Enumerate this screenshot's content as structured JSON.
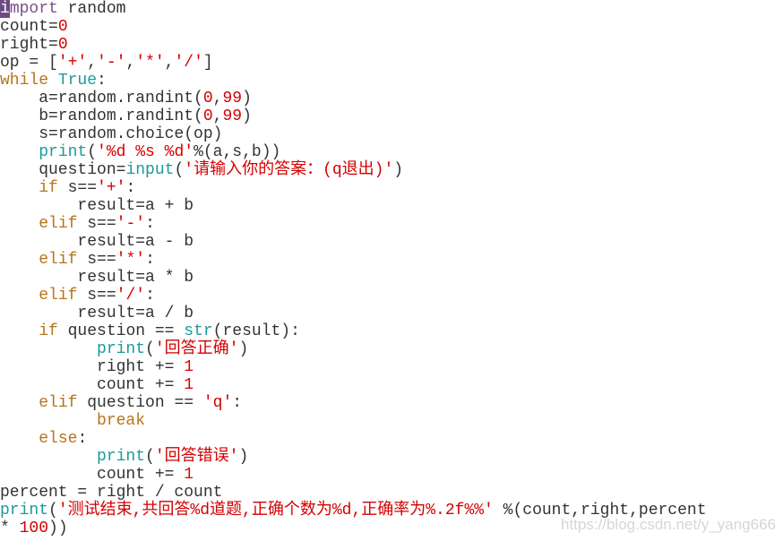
{
  "colors": {
    "keyword": "#b8741a",
    "import": "#7a4f8c",
    "builtin": "#1c9a9a",
    "string": "#d40000",
    "text": "#333333",
    "cursor": "#6b4b80"
  },
  "editor": {
    "lines": [
      [
        {
          "t": "i",
          "c": "cur"
        },
        {
          "t": "mport",
          "c": "imp"
        },
        {
          "t": " random",
          "c": "n"
        }
      ],
      [
        {
          "t": "count=",
          "c": "n"
        },
        {
          "t": "0",
          "c": "str"
        }
      ],
      [
        {
          "t": "right=",
          "c": "n"
        },
        {
          "t": "0",
          "c": "str"
        }
      ],
      [
        {
          "t": "op = [",
          "c": "n"
        },
        {
          "t": "'+'",
          "c": "str"
        },
        {
          "t": ",",
          "c": "n"
        },
        {
          "t": "'-'",
          "c": "str"
        },
        {
          "t": ",",
          "c": "n"
        },
        {
          "t": "'*'",
          "c": "str"
        },
        {
          "t": ",",
          "c": "n"
        },
        {
          "t": "'/'",
          "c": "str"
        },
        {
          "t": "]",
          "c": "n"
        }
      ],
      [
        {
          "t": "while",
          "c": "kw"
        },
        {
          "t": " ",
          "c": "n"
        },
        {
          "t": "True",
          "c": "bi"
        },
        {
          "t": ":",
          "c": "n"
        }
      ],
      [
        {
          "t": "    a=random.randint(",
          "c": "n"
        },
        {
          "t": "0",
          "c": "str"
        },
        {
          "t": ",",
          "c": "n"
        },
        {
          "t": "99",
          "c": "str"
        },
        {
          "t": ")",
          "c": "n"
        }
      ],
      [
        {
          "t": "    b=random.randint(",
          "c": "n"
        },
        {
          "t": "0",
          "c": "str"
        },
        {
          "t": ",",
          "c": "n"
        },
        {
          "t": "99",
          "c": "str"
        },
        {
          "t": ")",
          "c": "n"
        }
      ],
      [
        {
          "t": "    s=random.choice(op)",
          "c": "n"
        }
      ],
      [
        {
          "t": "    ",
          "c": "n"
        },
        {
          "t": "print",
          "c": "bi"
        },
        {
          "t": "(",
          "c": "n"
        },
        {
          "t": "'%d %s %d'",
          "c": "str"
        },
        {
          "t": "%(a,s,b))",
          "c": "n"
        }
      ],
      [
        {
          "t": "    question=",
          "c": "n"
        },
        {
          "t": "input",
          "c": "bi"
        },
        {
          "t": "(",
          "c": "n"
        },
        {
          "t": "'请输入你的答案：(q退出)'",
          "c": "str"
        },
        {
          "t": ")",
          "c": "n"
        }
      ],
      [
        {
          "t": "    ",
          "c": "n"
        },
        {
          "t": "if",
          "c": "kw"
        },
        {
          "t": " s==",
          "c": "n"
        },
        {
          "t": "'+'",
          "c": "str"
        },
        {
          "t": ":",
          "c": "n"
        }
      ],
      [
        {
          "t": "        result=a + b",
          "c": "n"
        }
      ],
      [
        {
          "t": "    ",
          "c": "n"
        },
        {
          "t": "elif",
          "c": "kw"
        },
        {
          "t": " s==",
          "c": "n"
        },
        {
          "t": "'-'",
          "c": "str"
        },
        {
          "t": ":",
          "c": "n"
        }
      ],
      [
        {
          "t": "        result=a - b",
          "c": "n"
        }
      ],
      [
        {
          "t": "    ",
          "c": "n"
        },
        {
          "t": "elif",
          "c": "kw"
        },
        {
          "t": " s==",
          "c": "n"
        },
        {
          "t": "'*'",
          "c": "str"
        },
        {
          "t": ":",
          "c": "n"
        }
      ],
      [
        {
          "t": "        result=a * b",
          "c": "n"
        }
      ],
      [
        {
          "t": "    ",
          "c": "n"
        },
        {
          "t": "elif",
          "c": "kw"
        },
        {
          "t": " s==",
          "c": "n"
        },
        {
          "t": "'/'",
          "c": "str"
        },
        {
          "t": ":",
          "c": "n"
        }
      ],
      [
        {
          "t": "        result=a / b",
          "c": "n"
        }
      ],
      [
        {
          "t": "    ",
          "c": "n"
        },
        {
          "t": "if",
          "c": "kw"
        },
        {
          "t": " question == ",
          "c": "n"
        },
        {
          "t": "str",
          "c": "bi"
        },
        {
          "t": "(result):",
          "c": "n"
        }
      ],
      [
        {
          "t": "          ",
          "c": "n"
        },
        {
          "t": "print",
          "c": "bi"
        },
        {
          "t": "(",
          "c": "n"
        },
        {
          "t": "'回答正确'",
          "c": "str"
        },
        {
          "t": ")",
          "c": "n"
        }
      ],
      [
        {
          "t": "          right += ",
          "c": "n"
        },
        {
          "t": "1",
          "c": "str"
        }
      ],
      [
        {
          "t": "          count += ",
          "c": "n"
        },
        {
          "t": "1",
          "c": "str"
        }
      ],
      [
        {
          "t": "    ",
          "c": "n"
        },
        {
          "t": "elif",
          "c": "kw"
        },
        {
          "t": " question == ",
          "c": "n"
        },
        {
          "t": "'q'",
          "c": "str"
        },
        {
          "t": ":",
          "c": "n"
        }
      ],
      [
        {
          "t": "          ",
          "c": "n"
        },
        {
          "t": "break",
          "c": "kw"
        }
      ],
      [
        {
          "t": "    ",
          "c": "n"
        },
        {
          "t": "else",
          "c": "kw"
        },
        {
          "t": ":",
          "c": "n"
        }
      ],
      [
        {
          "t": "          ",
          "c": "n"
        },
        {
          "t": "print",
          "c": "bi"
        },
        {
          "t": "(",
          "c": "n"
        },
        {
          "t": "'回答错误'",
          "c": "str"
        },
        {
          "t": ")",
          "c": "n"
        }
      ],
      [
        {
          "t": "          count += ",
          "c": "n"
        },
        {
          "t": "1",
          "c": "str"
        }
      ],
      [
        {
          "t": "percent = right / count",
          "c": "n"
        }
      ],
      [
        {
          "t": "print",
          "c": "bi"
        },
        {
          "t": "(",
          "c": "n"
        },
        {
          "t": "'测试结束,共回答%d道题,正确个数为%d,正确率为%.2f%%'",
          "c": "str"
        },
        {
          "t": " %(count,right,percent",
          "c": "n"
        }
      ],
      [
        {
          "t": "* ",
          "c": "n"
        },
        {
          "t": "100",
          "c": "str"
        },
        {
          "t": "))",
          "c": "n"
        }
      ]
    ]
  },
  "watermark": "https://blog.csdn.net/y_yang666"
}
